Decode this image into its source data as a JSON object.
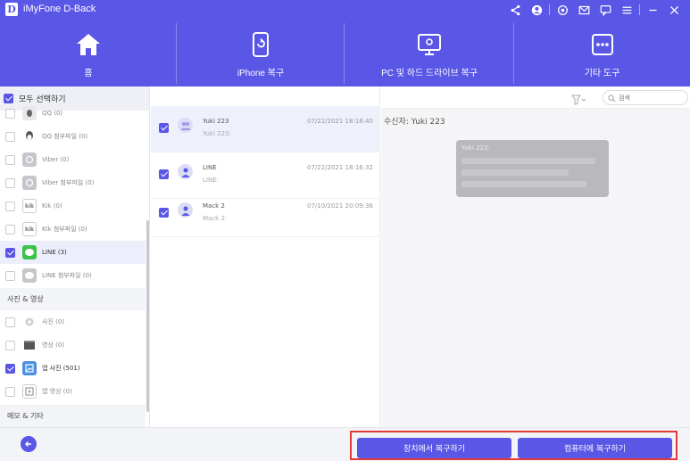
{
  "app": {
    "logo_letter": "D",
    "title": "iMyFone D-Back",
    "accent_color": "#5a56e6",
    "window_icons": [
      "share-icon",
      "account-icon",
      "settings-icon",
      "mail-icon",
      "chat-icon",
      "menu-icon",
      "minimize-icon",
      "close-icon"
    ]
  },
  "nav": {
    "items": [
      {
        "label": "홈",
        "icon": "home-icon"
      },
      {
        "label": "iPhone 복구",
        "icon": "iphone-recover-icon"
      },
      {
        "label": "PC 및 하드 드라이브 복구",
        "icon": "pc-recover-icon"
      },
      {
        "label": "기타 도구",
        "icon": "more-tools-icon"
      }
    ]
  },
  "sidebar": {
    "select_all": "모두 선택하기",
    "items": [
      {
        "label": "QQ (0)",
        "checked": false,
        "icon": "qq-icon"
      },
      {
        "label": "QQ 첨부파일 (0)",
        "checked": false,
        "icon": "qq-icon"
      },
      {
        "label": "Viber (0)",
        "checked": false,
        "icon": "viber-icon"
      },
      {
        "label": "Viber 첨부파일 (0)",
        "checked": false,
        "icon": "viber-icon"
      },
      {
        "label": "Kik (0)",
        "checked": false,
        "icon": "kik-icon"
      },
      {
        "label": "Kik 첨부파일 (0)",
        "checked": false,
        "icon": "kik-icon"
      },
      {
        "label": "LINE (3)",
        "checked": true,
        "icon": "line-icon"
      },
      {
        "label": "LINE 첨부파일 (0)",
        "checked": false,
        "icon": "line-icon"
      }
    ],
    "category_photo": "사진 & 영상",
    "photo_items": [
      {
        "label": "사진 (0)",
        "checked": false,
        "icon": "photo-icon"
      },
      {
        "label": "영상 (0)",
        "checked": false,
        "icon": "video-icon"
      },
      {
        "label": "앱 사진 (501)",
        "checked": true,
        "icon": "app-photo-icon"
      },
      {
        "label": "앱 영상 (0)",
        "checked": false,
        "icon": "app-video-icon"
      }
    ],
    "category_memo": "메모 & 기타"
  },
  "messages": [
    {
      "name": "Yuki 223",
      "preview": "Yuki 223:",
      "time": "07/22/2021 18:18:40",
      "checked": true
    },
    {
      "name": "LINE",
      "preview": "LINE:",
      "time": "07/22/2021 18:16:32",
      "checked": true
    },
    {
      "name": "Mack 2",
      "preview": "Mack 2:",
      "time": "07/10/2021 20:09:36",
      "checked": true
    }
  ],
  "detail": {
    "search_placeholder": "검색",
    "recipient": "수신자: Yuki 223",
    "bubble_name": "Yuki 223:"
  },
  "bottom": {
    "recover_device": "장치에서 복구하기",
    "recover_pc": "컴퓨터에 복구하기",
    "highlight_color": "#e53935"
  }
}
